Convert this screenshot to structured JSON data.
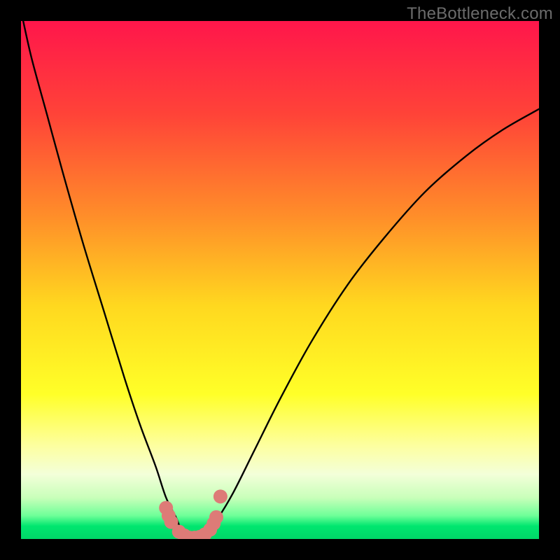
{
  "watermark": "TheBottleneck.com",
  "chart_data": {
    "type": "line",
    "title": "",
    "xlabel": "",
    "ylabel": "",
    "xlim": [
      0,
      100
    ],
    "ylim": [
      0,
      100
    ],
    "gradient_stops": [
      {
        "offset": 0.0,
        "color": "#ff164b"
      },
      {
        "offset": 0.18,
        "color": "#ff4338"
      },
      {
        "offset": 0.38,
        "color": "#ff8f29"
      },
      {
        "offset": 0.55,
        "color": "#ffd81f"
      },
      {
        "offset": 0.72,
        "color": "#ffff28"
      },
      {
        "offset": 0.82,
        "color": "#fdffa0"
      },
      {
        "offset": 0.875,
        "color": "#f3ffd9"
      },
      {
        "offset": 0.92,
        "color": "#c9ffba"
      },
      {
        "offset": 0.955,
        "color": "#6eff98"
      },
      {
        "offset": 0.975,
        "color": "#00e66f"
      },
      {
        "offset": 1.0,
        "color": "#00d768"
      }
    ],
    "series": [
      {
        "name": "bottleneck-curve",
        "x": [
          0,
          2,
          5,
          8,
          12,
          16,
          20,
          23,
          26,
          28,
          30,
          31,
          32,
          33,
          34,
          36,
          38,
          41,
          45,
          50,
          56,
          63,
          70,
          78,
          86,
          93,
          100
        ],
        "y": [
          102,
          93,
          82,
          71,
          57,
          44,
          31,
          22,
          14,
          8,
          4,
          1.5,
          0.5,
          0.2,
          0.5,
          1.5,
          4,
          9,
          17,
          27,
          38,
          49,
          58,
          67,
          74,
          79,
          83
        ]
      }
    ],
    "markers": {
      "name": "highlight-points",
      "x": [
        28.0,
        28.5,
        29.0,
        30.5,
        31.5,
        32.5,
        33.5,
        34.5,
        35.5,
        36.5,
        37.2,
        37.7,
        38.5
      ],
      "y": [
        6.0,
        4.5,
        3.3,
        1.4,
        0.7,
        0.25,
        0.25,
        0.4,
        0.9,
        1.8,
        3.0,
        4.2,
        8.2
      ],
      "color": "#dd7b77",
      "radius": 10
    }
  }
}
